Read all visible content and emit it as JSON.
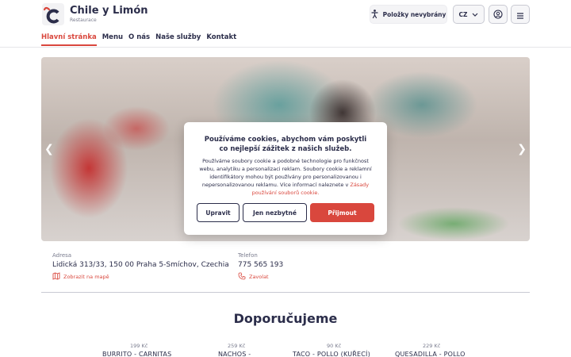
{
  "brand": {
    "name": "Chile y Limón",
    "subtitle": "Restaurace"
  },
  "header": {
    "accessibility_label": "Položky nevybrány",
    "language": "CZ"
  },
  "nav": [
    {
      "label": "Hlavní stránka",
      "active": true
    },
    {
      "label": "Menu"
    },
    {
      "label": "O nás"
    },
    {
      "label": "Naše služby"
    },
    {
      "label": "Kontakt"
    }
  ],
  "cookie": {
    "title": "Používáme cookies, abychom vám poskytli co nejlepší zážitek z našich služeb.",
    "text": "Používáme soubory cookie a podobné technologie pro funkčnost webu, analytiku a personalizaci reklam. Soubory cookie a reklamní identifikátory mohou být používány pro personalizovanou i nepersonalizovanou reklamu. Více informací naleznete v",
    "link": "Zásady používání souborů cookie.",
    "btn_customize": "Upravit",
    "btn_necessary": "Jen nezbytné",
    "btn_accept": "Přijmout"
  },
  "info": {
    "address_label": "Adresa",
    "address": "Lidická 313/33, 150 00 Praha 5-Smíchov, Czechia",
    "map_link": "Zobrazit na mapě",
    "phone_label": "Telefon",
    "phone": "775 565 193",
    "call_link": "Zavolat"
  },
  "recommendations": {
    "title": "Doporučujeme",
    "items": [
      {
        "price": "199 Kč",
        "name": "BURRITO - CARNITAS"
      },
      {
        "price": "259 Kč",
        "name": "NACHOS -"
      },
      {
        "price": "90 Kč",
        "name": "TACO - POLLO (KUŘECÍ)"
      },
      {
        "price": "229 Kč",
        "name": "QUESADILLA - POLLO"
      }
    ]
  },
  "colors": {
    "accent": "#d9473d",
    "text": "#2b2d4a"
  }
}
